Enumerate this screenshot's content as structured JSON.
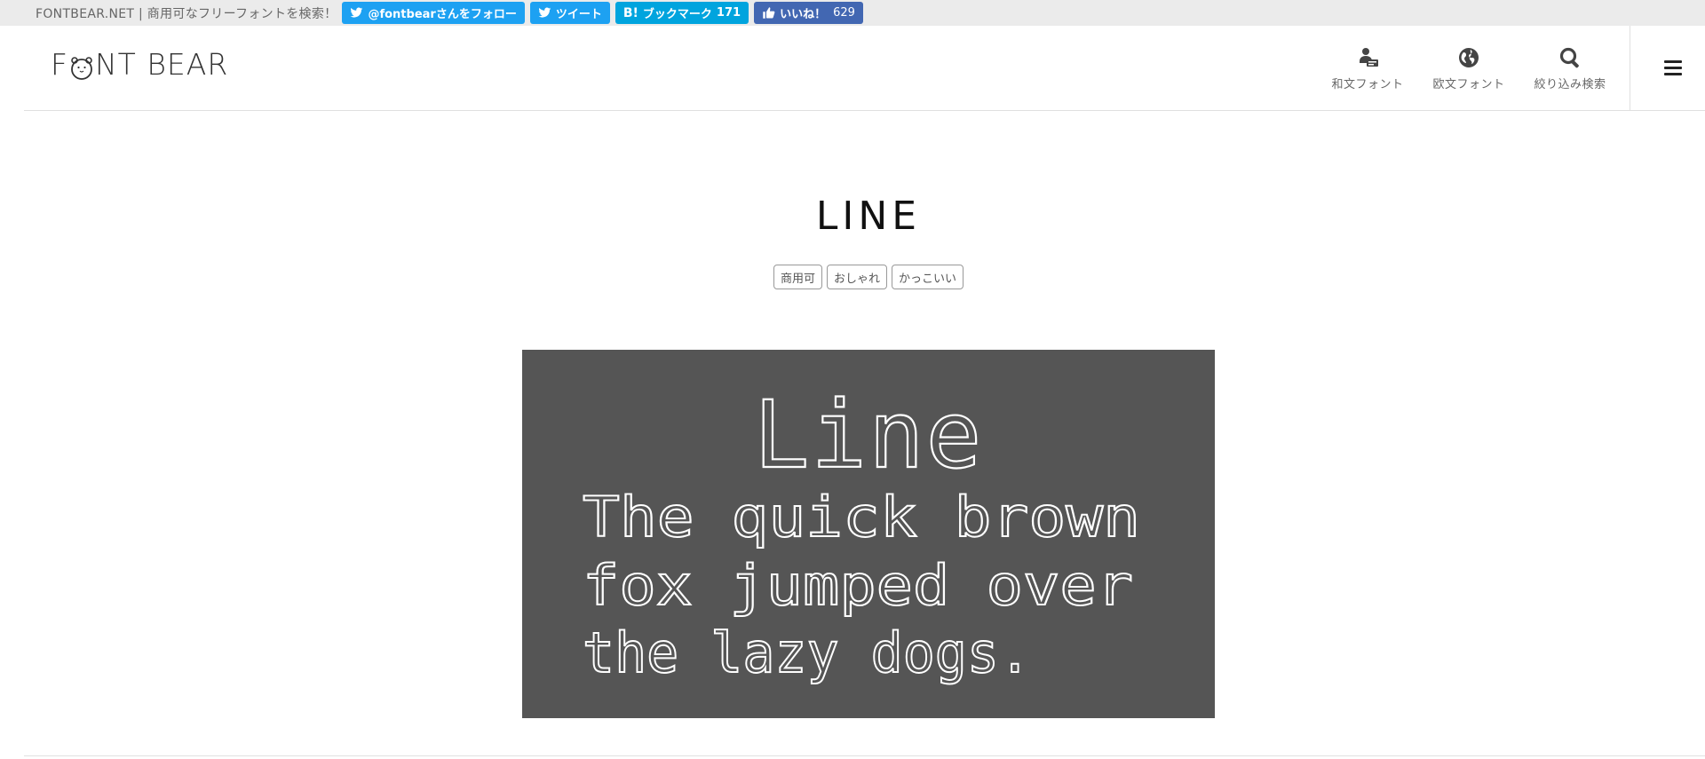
{
  "topbar": {
    "text": "FONTBEAR.NET | 商用可なフリーフォントを検索！",
    "follow_label": "@fontbearさんをフォロー",
    "tweet_label": "ツイート",
    "hatena_mark": "B!",
    "hatena_label": "ブックマーク",
    "hatena_count": "171",
    "like_label": "いいね！",
    "like_count": "629",
    "colors": {
      "twitter": "#1da1f2",
      "hatena": "#00a4de",
      "facebook": "#4267b2"
    }
  },
  "header": {
    "logo": "FONT BEAR",
    "logo_parts": {
      "first": "F",
      "rest": "NT BEAR"
    },
    "nav": [
      {
        "label": "和文フォント",
        "icon": "japanese-font-icon"
      },
      {
        "label": "欧文フォント",
        "icon": "globe-icon"
      },
      {
        "label": "絞り込み検索",
        "icon": "search-icon"
      }
    ],
    "menu_icon": "hamburger-menu-icon"
  },
  "main": {
    "title": "LINE",
    "tags": [
      "商用可",
      "おしゃれ",
      "かっこいい"
    ],
    "preview": {
      "background": "#555555",
      "lines": [
        "Line",
        "The quick brown",
        "fox jumped over",
        "the lazy dogs."
      ]
    }
  }
}
